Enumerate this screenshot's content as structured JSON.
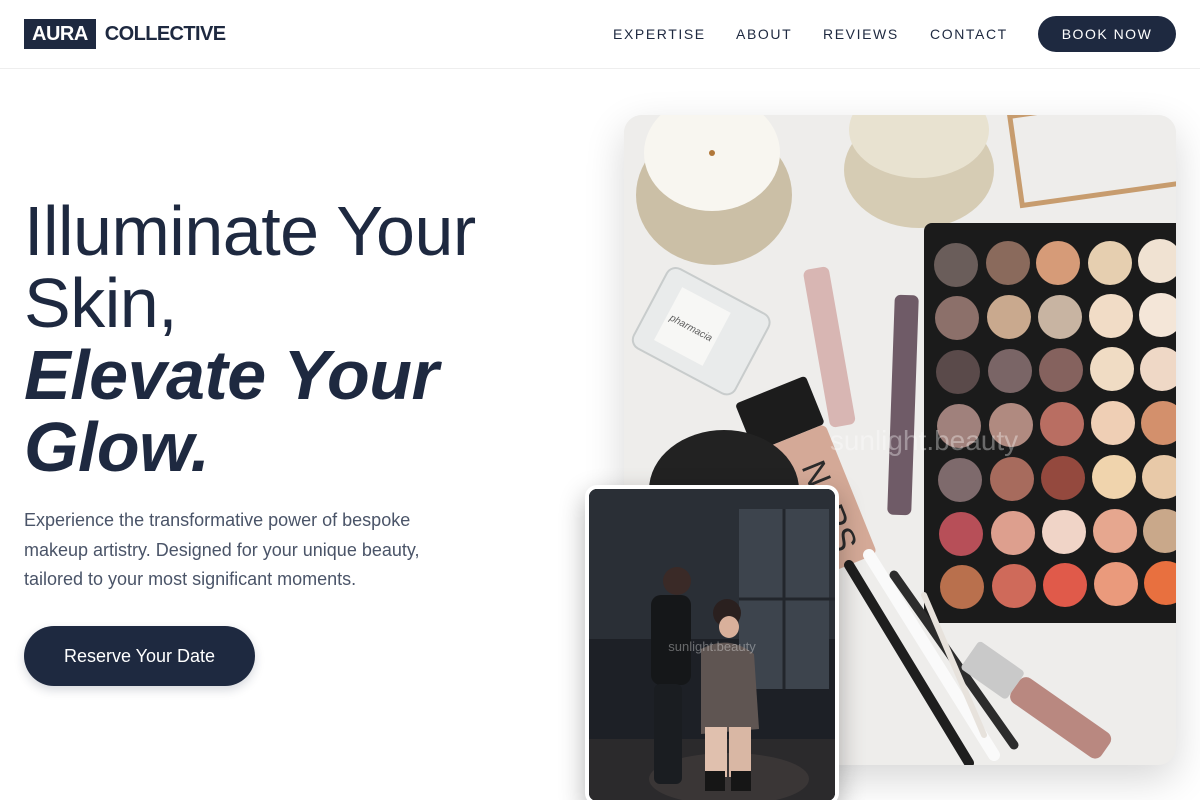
{
  "brand": {
    "logo_box": "AURA",
    "logo_text": "COLLECTIVE"
  },
  "nav": {
    "items": [
      {
        "label": "EXPERTISE"
      },
      {
        "label": "ABOUT"
      },
      {
        "label": "REVIEWS"
      },
      {
        "label": "CONTACT"
      }
    ],
    "cta_label": "BOOK NOW"
  },
  "hero": {
    "headline_line1": "Illuminate Your",
    "headline_line2": "Skin,",
    "headline_line3": "Elevate Your",
    "headline_line4": "Glow.",
    "description": "Experience the transformative power of bespoke makeup artistry. Designed for your unique beauty, tailored to your most significant moments.",
    "cta_label": "Reserve Your Date"
  },
  "images": {
    "main_watermark": "sunlight.beauty",
    "inset_watermark": "sunlight.beauty",
    "bottle_label": "pharmacia",
    "foundation_label": "NARS"
  },
  "colors": {
    "primary": "#1e2940",
    "text_muted": "#4a5468",
    "background": "#ffffff"
  }
}
